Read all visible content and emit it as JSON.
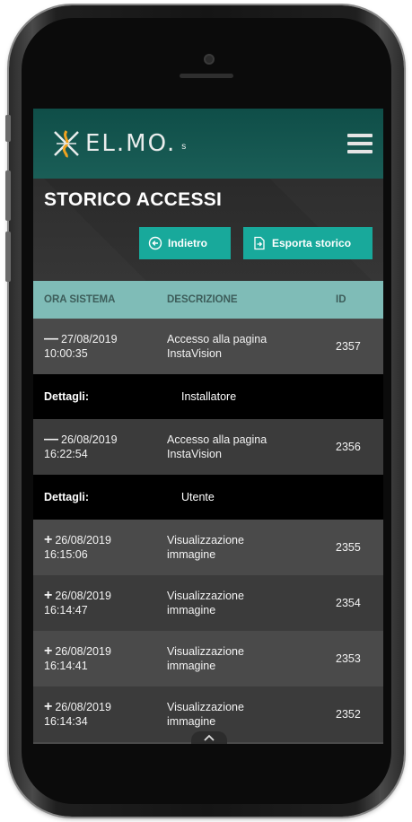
{
  "app": {
    "logo_text": "EL.MO.",
    "logo_dot": "s"
  },
  "page": {
    "title": "STORICO ACCESSI"
  },
  "buttons": {
    "back_label": "Indietro",
    "export_label": "Esporta storico"
  },
  "table": {
    "headers": {
      "time": "ORA SISTEMA",
      "description": "DESCRIZIONE",
      "id": "ID"
    },
    "details_label": "Dettagli:",
    "rows": [
      {
        "sign": "—",
        "date": "27/08/2019",
        "time": "10:00:35",
        "desc1": "Accesso alla pagina",
        "desc2": "InstaVision",
        "id": "2357",
        "details": "Installatore"
      },
      {
        "sign": "—",
        "date": "26/08/2019",
        "time": "16:22:54",
        "desc1": "Accesso alla pagina",
        "desc2": "InstaVision",
        "id": "2356",
        "details": "Utente"
      },
      {
        "sign": "+",
        "date": "26/08/2019",
        "time": "16:15:06",
        "desc1": "Visualizzazione",
        "desc2": "immagine",
        "id": "2355"
      },
      {
        "sign": "+",
        "date": "26/08/2019",
        "time": "16:14:47",
        "desc1": "Visualizzazione",
        "desc2": "immagine",
        "id": "2354"
      },
      {
        "sign": "+",
        "date": "26/08/2019",
        "time": "16:14:41",
        "desc1": "Visualizzazione",
        "desc2": "immagine",
        "id": "2353"
      },
      {
        "sign": "+",
        "date": "26/08/2019",
        "time": "16:14:34",
        "desc1": "Visualizzazione",
        "desc2": "immagine",
        "id": "2352"
      }
    ]
  },
  "colors": {
    "accent": "#18a99b",
    "header_bg": "#7fbcb7",
    "appbar": "#1a5e57"
  },
  "icons": {
    "menu": "hamburger-icon",
    "back": "arrow-left-circle-icon",
    "export": "file-export-icon",
    "scroll": "chevron-up-icon"
  }
}
